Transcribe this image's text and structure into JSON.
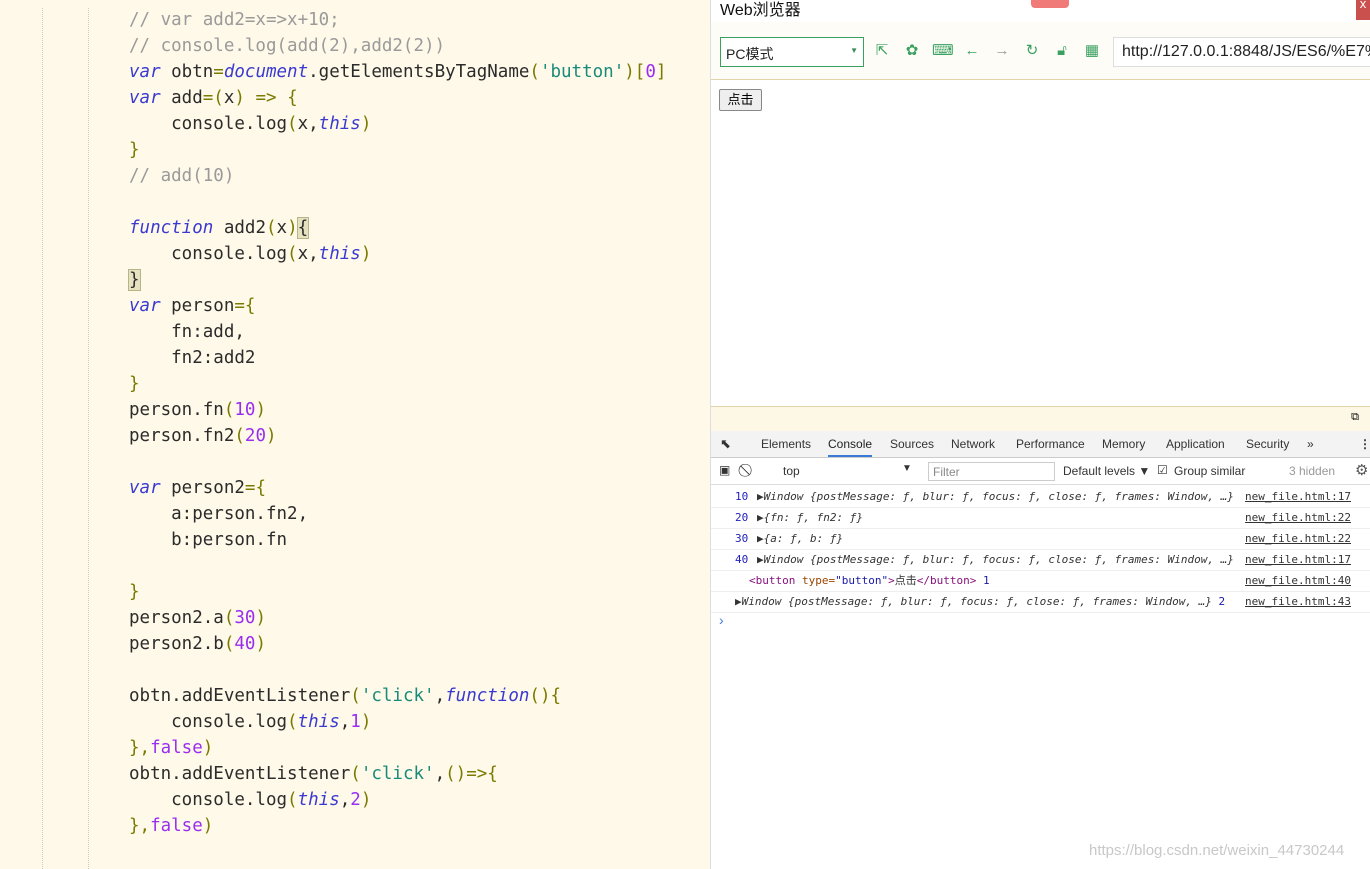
{
  "code": {
    "lines": [
      [
        [
          "c",
          "// var add2=x=>x+10;"
        ]
      ],
      [
        [
          "c",
          "// console.log(add(2),add2(2))"
        ]
      ],
      [
        [
          "k",
          "var"
        ],
        [
          "t",
          " obtn"
        ],
        [
          "p",
          "="
        ],
        [
          "i",
          "document"
        ],
        [
          "t",
          ".getElementsByTagName"
        ],
        [
          "p",
          "("
        ],
        [
          "s",
          "'button'"
        ],
        [
          "p",
          ")["
        ],
        [
          "n",
          "0"
        ],
        [
          "p",
          "]"
        ]
      ],
      [
        [
          "k",
          "var"
        ],
        [
          "t",
          " add"
        ],
        [
          "p",
          "=("
        ],
        [
          "t",
          "x"
        ],
        [
          "p",
          ") => {"
        ]
      ],
      [
        [
          "t",
          "    console.log"
        ],
        [
          "p",
          "("
        ],
        [
          "t",
          "x,"
        ],
        [
          "i",
          "this"
        ],
        [
          "p",
          ")"
        ]
      ],
      [
        [
          "p",
          "}"
        ]
      ],
      [
        [
          "c",
          "// add(10)"
        ]
      ],
      [],
      [
        [
          "k",
          "function"
        ],
        [
          "t",
          " add2"
        ],
        [
          "p",
          "("
        ],
        [
          "t",
          "x"
        ],
        [
          "p",
          ")"
        ],
        [
          "m",
          "{"
        ]
      ],
      [
        [
          "t",
          "    console.log"
        ],
        [
          "p",
          "("
        ],
        [
          "t",
          "x,"
        ],
        [
          "i",
          "this"
        ],
        [
          "p",
          ")"
        ]
      ],
      [
        [
          "m",
          "}"
        ]
      ],
      [
        [
          "k",
          "var"
        ],
        [
          "t",
          " person"
        ],
        [
          "p",
          "={"
        ]
      ],
      [
        [
          "t",
          "    fn:add,"
        ]
      ],
      [
        [
          "t",
          "    fn2:add2"
        ]
      ],
      [
        [
          "p",
          "}"
        ]
      ],
      [
        [
          "t",
          "person.fn"
        ],
        [
          "p",
          "("
        ],
        [
          "n",
          "10"
        ],
        [
          "p",
          ")"
        ]
      ],
      [
        [
          "t",
          "person.fn2"
        ],
        [
          "p",
          "("
        ],
        [
          "n",
          "20"
        ],
        [
          "p",
          ")"
        ]
      ],
      [],
      [
        [
          "k",
          "var"
        ],
        [
          "t",
          " person2"
        ],
        [
          "p",
          "={"
        ]
      ],
      [
        [
          "t",
          "    a:person.fn2,"
        ]
      ],
      [
        [
          "t",
          "    b:person.fn"
        ]
      ],
      [],
      [
        [
          "p",
          "}"
        ]
      ],
      [
        [
          "t",
          "person2.a"
        ],
        [
          "p",
          "("
        ],
        [
          "n",
          "30"
        ],
        [
          "p",
          ")"
        ]
      ],
      [
        [
          "t",
          "person2.b"
        ],
        [
          "p",
          "("
        ],
        [
          "n",
          "40"
        ],
        [
          "p",
          ")"
        ]
      ],
      [],
      [
        [
          "t",
          "obtn.addEventListener"
        ],
        [
          "p",
          "("
        ],
        [
          "s",
          "'click'"
        ],
        [
          "t",
          ","
        ],
        [
          "k",
          "function"
        ],
        [
          "p",
          "(){"
        ]
      ],
      [
        [
          "t",
          "    console.log"
        ],
        [
          "p",
          "("
        ],
        [
          "i",
          "this"
        ],
        [
          "t",
          ","
        ],
        [
          "n",
          "1"
        ],
        [
          "p",
          ")"
        ]
      ],
      [
        [
          "p",
          "},"
        ],
        [
          "n",
          "false"
        ],
        [
          "p",
          ")"
        ]
      ],
      [
        [
          "t",
          "obtn.addEventListener"
        ],
        [
          "p",
          "("
        ],
        [
          "s",
          "'click'"
        ],
        [
          "t",
          ","
        ],
        [
          "p",
          "()=>{"
        ]
      ],
      [
        [
          "t",
          "    console.log"
        ],
        [
          "p",
          "("
        ],
        [
          "i",
          "this"
        ],
        [
          "t",
          ","
        ],
        [
          "n",
          "2"
        ],
        [
          "p",
          ")"
        ]
      ],
      [
        [
          "p",
          "},"
        ],
        [
          "n",
          "false"
        ],
        [
          "p",
          ")"
        ]
      ]
    ]
  },
  "browser": {
    "title": "Web浏览器",
    "close": "x",
    "mode": "PC模式",
    "url": "http://127.0.0.1:8848/JS/ES6/%E7%",
    "page_button": "点击"
  },
  "devtools": {
    "tabs": [
      "Elements",
      "Console",
      "Sources",
      "Network",
      "Performance",
      "Memory",
      "Application",
      "Security"
    ],
    "more": "»",
    "context": "top",
    "filter_placeholder": "Filter",
    "levels": "Default levels ▼",
    "group_similar": "Group similar",
    "hidden": "3 hidden",
    "rows": [
      {
        "num": "10",
        "msg": "▶Window {postMessage: ƒ, blur: ƒ, focus: ƒ, close: ƒ, frames: Window, …}",
        "src": "new_file.html:17"
      },
      {
        "num": "20",
        "msg": "▶{fn: ƒ, fn2: ƒ}",
        "src": "new_file.html:22"
      },
      {
        "num": "30",
        "msg": "▶{a: ƒ, b: ƒ}",
        "src": "new_file.html:22"
      },
      {
        "num": "40",
        "msg": "▶Window {postMessage: ƒ, blur: ƒ, focus: ƒ, close: ƒ, frames: Window, …}",
        "src": "new_file.html:17"
      },
      {
        "num": "",
        "tag_open": "<button ",
        "attr": "type=",
        "val": "\"button\"",
        "tag_close": ">",
        "text": "点击",
        "tag_end": "</button>",
        "suffix": " 1",
        "src": "new_file.html:40"
      },
      {
        "num": "",
        "msg": "▶Window {postMessage: ƒ, blur: ƒ, focus: ƒ, close: ƒ, frames: Window, …}",
        "suffix": " 2",
        "src": "new_file.html:43"
      }
    ],
    "prompt": "›"
  },
  "watermark": "https://blog.csdn.net/weixin_44730244"
}
